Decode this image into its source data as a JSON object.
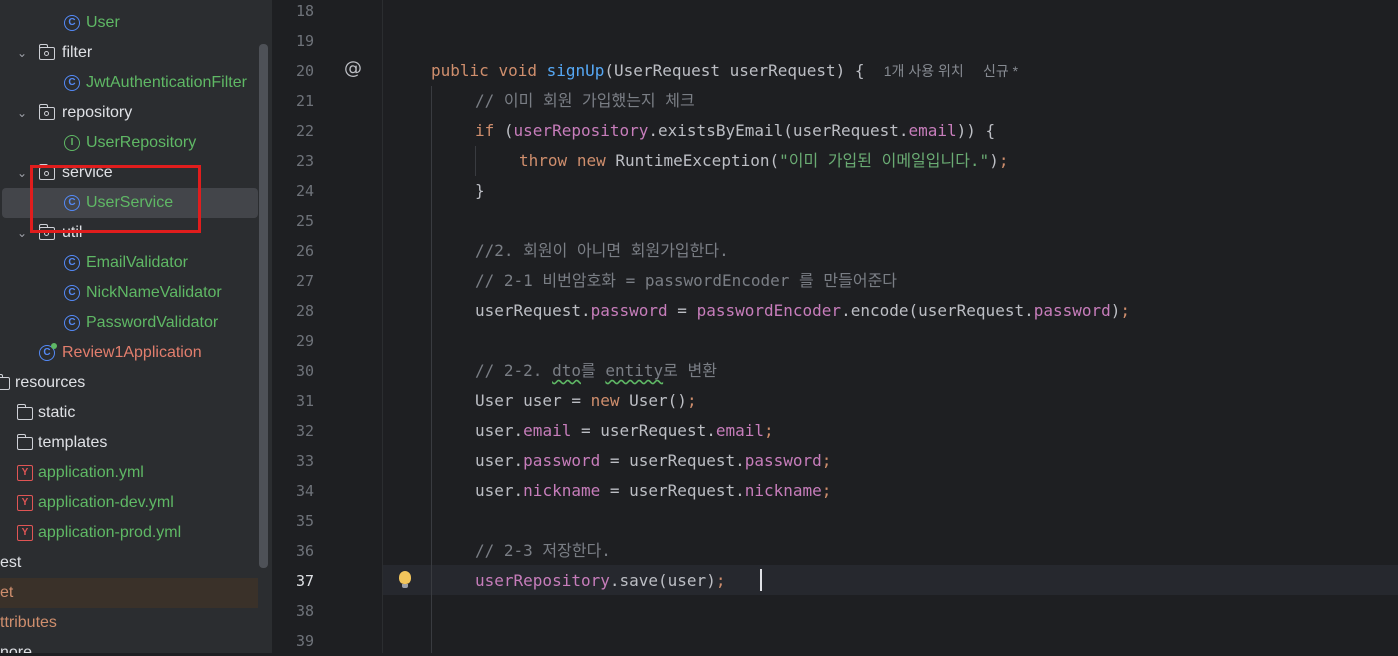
{
  "colors": {
    "sidebar_bg": "#2b2d30",
    "editor_bg": "#1e1f22",
    "highlight_box": "#e01d1d",
    "keyword": "#cf8e6d",
    "function": "#56a8f5",
    "field": "#c77dbb",
    "comment": "#7a7e85",
    "string": "#6aab73",
    "vcs_new_file": "#5fb865"
  },
  "sidebar": {
    "items": [
      {
        "label": "User",
        "icon": "class-icon",
        "color": "green"
      },
      {
        "label": "filter",
        "icon": "package-folder-icon",
        "color": "white"
      },
      {
        "label": "JwtAuthenticationFilter",
        "icon": "class-icon",
        "color": "green"
      },
      {
        "label": "repository",
        "icon": "package-folder-icon",
        "color": "white"
      },
      {
        "label": "UserRepository",
        "icon": "interface-icon",
        "color": "green"
      },
      {
        "label": "service",
        "icon": "package-folder-icon",
        "color": "white"
      },
      {
        "label": "UserService",
        "icon": "class-icon",
        "color": "green"
      },
      {
        "label": "util",
        "icon": "package-folder-icon",
        "color": "white"
      },
      {
        "label": "EmailValidator",
        "icon": "class-icon",
        "color": "green"
      },
      {
        "label": "NickNameValidator",
        "icon": "class-icon",
        "color": "green"
      },
      {
        "label": "PasswordValidator",
        "icon": "class-icon",
        "color": "green"
      },
      {
        "label": "Review1Application",
        "icon": "spring-app-icon",
        "color": "red"
      },
      {
        "label": "resources",
        "icon": "folder-icon",
        "color": "white"
      },
      {
        "label": "static",
        "icon": "folder-icon",
        "color": "white"
      },
      {
        "label": "templates",
        "icon": "folder-icon",
        "color": "white"
      },
      {
        "label": "application.yml",
        "icon": "yaml-icon",
        "color": "green"
      },
      {
        "label": "application-dev.yml",
        "icon": "yaml-icon",
        "color": "green"
      },
      {
        "label": "application-prod.yml",
        "icon": "yaml-icon",
        "color": "green"
      },
      {
        "label": "est",
        "color": "white"
      },
      {
        "label": "et",
        "color": "orange"
      },
      {
        "label": "ttributes",
        "color": "orange"
      },
      {
        "label": "nore",
        "color": "white"
      }
    ]
  },
  "editor": {
    "line_numbers": [
      "18",
      "19",
      "20",
      "21",
      "22",
      "23",
      "24",
      "25",
      "26",
      "27",
      "28",
      "29",
      "30",
      "31",
      "32",
      "33",
      "34",
      "35",
      "36",
      "37",
      "38",
      "39"
    ],
    "current_line": "37",
    "inlay_usages": "1개 사용 위치",
    "inlay_new": "신규 *",
    "code": {
      "l20_kw1": "public",
      "l20_kw2": "void",
      "l20_fn": "signUp",
      "l20_rest": "(UserRequest userRequest) {",
      "l21": "// 이미 회원 가입했는지 체크",
      "l22_kw": "if",
      "l22_a": " (",
      "l22_field1": "userRepository",
      "l22_b": ".existsByEmail(userRequest.",
      "l22_field2": "email",
      "l22_c": ")) {",
      "l23_kw1": "throw",
      "l23_kw2": "new",
      "l23_a": " RuntimeException(",
      "l23_str": "\"이미 가입된 이메일입니다.\"",
      "l23_b": ")",
      "l23_semi": ";",
      "l24": "}",
      "l26": "//2. 회원이 아니면 회원가입한다.",
      "l27": "// 2-1 비번암호화 = passwordEncoder 를 만들어준다",
      "l28_a": "userRequest.",
      "l28_f1": "password",
      "l28_b": " = ",
      "l28_f2": "passwordEncoder",
      "l28_c": ".encode(userRequest.",
      "l28_f3": "password",
      "l28_d": ")",
      "l28_semi": ";",
      "l30_a": "// 2-2. ",
      "l30_w1": "dto",
      "l30_b": "를 ",
      "l30_w2": "entity",
      "l30_c": "로 변환",
      "l31_a": "User user = ",
      "l31_kw": "new",
      "l31_b": " User()",
      "l31_semi": ";",
      "l32_a": "user.",
      "l32_f1": "email",
      "l32_b": " = userRequest.",
      "l32_f2": "email",
      "l32_semi": ";",
      "l33_a": "user.",
      "l33_f1": "password",
      "l33_b": " = userRequest.",
      "l33_f2": "password",
      "l33_semi": ";",
      "l34_a": "user.",
      "l34_f1": "nickname",
      "l34_b": " = userRequest.",
      "l34_f2": "nickname",
      "l34_semi": ";",
      "l36": "// 2-3 저장한다.",
      "l37_f1": "userRepository",
      "l37_a": ".save(user)",
      "l37_semi": ";"
    }
  }
}
